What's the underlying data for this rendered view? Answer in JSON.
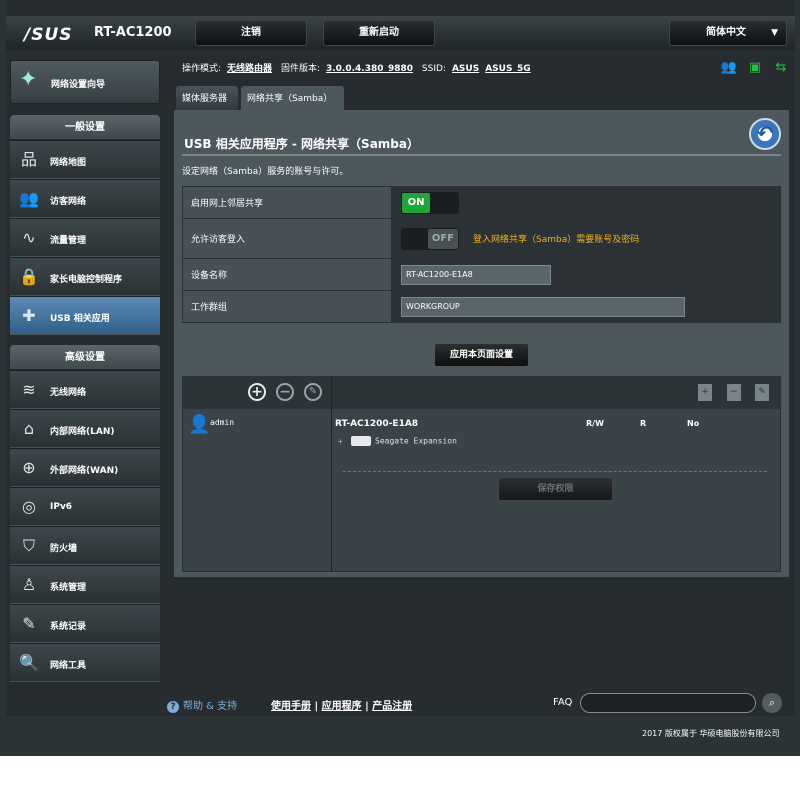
{
  "header": {
    "brand": "/SUS",
    "model": "RT-AC1200",
    "logout_label": "注销",
    "reboot_label": "重新启动",
    "language": "简体中文"
  },
  "wizard": {
    "label": "网络设置向导"
  },
  "nav": {
    "general_header": "一般设置",
    "general_items": [
      {
        "label": "网络地图",
        "icon": "network-map-icon"
      },
      {
        "label": "访客网络",
        "icon": "guest-network-icon"
      },
      {
        "label": "流量管理",
        "icon": "traffic-icon"
      },
      {
        "label": "家长电脑控制程序",
        "icon": "parental-control-icon"
      },
      {
        "label": "USB 相关应用",
        "icon": "usb-puzzle-icon"
      }
    ],
    "advanced_header": "高级设置",
    "advanced_items": [
      {
        "label": "无线网络",
        "icon": "wifi-icon"
      },
      {
        "label": "内部网络(LAN)",
        "icon": "lan-home-icon"
      },
      {
        "label": "外部网络(WAN)",
        "icon": "wan-globe-icon"
      },
      {
        "label": "IPv6",
        "icon": "ipv6-icon"
      },
      {
        "label": "防火墙",
        "icon": "shield-icon"
      },
      {
        "label": "系统管理",
        "icon": "admin-user-icon"
      },
      {
        "label": "系统记录",
        "icon": "log-icon"
      },
      {
        "label": "网络工具",
        "icon": "tools-icon"
      }
    ]
  },
  "status": {
    "mode_label": "操作模式:",
    "mode": "无线路由器",
    "fw_label": "固件版本:",
    "fw": "3.0.0.4.380_9880",
    "ssid_label": "SSID:",
    "ssid1": "ASUS",
    "ssid2": "ASUS_5G"
  },
  "tabs": [
    "媒体服务器",
    "网络共享（Samba）"
  ],
  "page": {
    "title": "USB 相关应用程序 - 网络共享（Samba）",
    "description": "设定网络（Samba）服务的账号与许可。",
    "rows": {
      "neighbor_label": "启用网上邻居共享",
      "neighbor_state": "ON",
      "guest_label": "允许访客登入",
      "guest_state": "OFF",
      "guest_hint": "登入网络共享（Samba）需要账号及密码",
      "device_label": "设备名称",
      "device_value": "RT-AC1200-E1A8",
      "workgroup_label": "工作群组",
      "workgroup_value": "WORKGROUP"
    },
    "apply_label": "应用本页面设置"
  },
  "share": {
    "user": "admin",
    "device": "RT-AC1200-E1A8",
    "perm_rw": "R/W",
    "perm_r": "R",
    "perm_no": "No",
    "disk": "Seagate Expansion",
    "save_label": "保存权限"
  },
  "footer": {
    "help": "帮助 & 支持",
    "manual": "使用手册",
    "apps": "应用程序",
    "register": "产品注册",
    "faq": "FAQ",
    "copyright": "2017 版权属于 华硕电脑股份有限公司"
  }
}
